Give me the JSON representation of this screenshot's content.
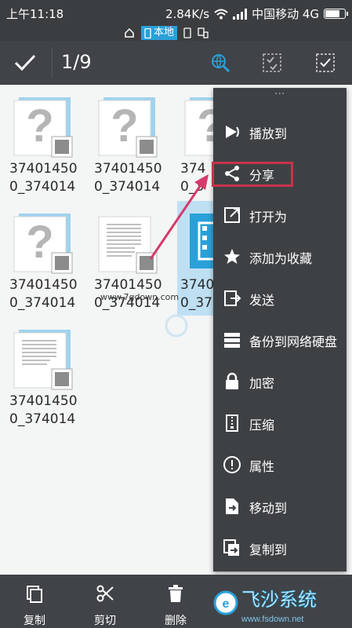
{
  "status": {
    "time": "上午11:18",
    "speed": "2.84K/s",
    "carrier": "中国移动 4G",
    "battery_level": 0.8
  },
  "location": {
    "active_label": "本地"
  },
  "action_bar": {
    "selection_count": "1/9"
  },
  "files": [
    {
      "line1": "37401450",
      "line2": "0_374014",
      "type": "unknown"
    },
    {
      "line1": "37401450",
      "line2": "0_374014",
      "type": "unknown"
    },
    {
      "line1": "374",
      "line2": "0_3",
      "type": "unknown"
    },
    {
      "line1": "37401450",
      "line2": "0_374014",
      "type": "unknown"
    },
    {
      "line1": "37401450",
      "line2": "0_374014",
      "type": "document"
    },
    {
      "line1": "3740",
      "line2": "0_37",
      "type": "video",
      "selected": true
    },
    {
      "line1": "37401450",
      "line2": "0_374014",
      "type": "document"
    }
  ],
  "watermark": "www.7gdown.com",
  "menu": {
    "partial_top": "...",
    "items": [
      {
        "label": "播放到",
        "icon": "cast-icon"
      },
      {
        "label": "分享",
        "icon": "share-icon",
        "highlighted": true
      },
      {
        "label": "打开为",
        "icon": "open-as-icon"
      },
      {
        "label": "添加为收藏",
        "icon": "star-icon"
      },
      {
        "label": "发送",
        "icon": "send-icon"
      },
      {
        "label": "备份到网络硬盘",
        "icon": "backup-icon"
      },
      {
        "label": "加密",
        "icon": "lock-icon"
      },
      {
        "label": "压缩",
        "icon": "zip-icon"
      },
      {
        "label": "属性",
        "icon": "info-icon"
      },
      {
        "label": "移动到",
        "icon": "move-icon"
      },
      {
        "label": "复制到",
        "icon": "copy-to-icon"
      }
    ]
  },
  "bottom_bar": [
    {
      "label": "复制",
      "icon": "copy-icon"
    },
    {
      "label": "剪切",
      "icon": "scissors-icon"
    },
    {
      "label": "删除",
      "icon": "trash-icon"
    }
  ],
  "logo": {
    "text": "飞沙系统",
    "url": "www.fsdown.net"
  },
  "colors": {
    "accent": "#2aa0d8",
    "highlight": "#c8334a",
    "toolbar": "#404347"
  }
}
